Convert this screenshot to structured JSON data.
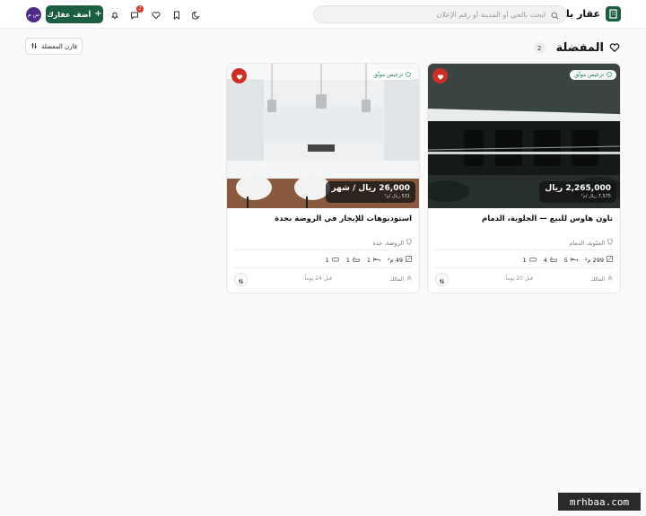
{
  "header": {
    "brand": "عقار بلس",
    "search_placeholder": "ابحث بالحي أو المدينة أو رقم الإعلان",
    "add_button": "أضف عقارك",
    "messages_badge": "2",
    "avatar_text": "س م"
  },
  "page": {
    "title": "المفضلة",
    "count": "2",
    "compare_button": "قارن المفضلة"
  },
  "cards": [
    {
      "verified": "ترخيص موثّق",
      "price": "2,265,000 ريال",
      "per_meter": "7,575 ريال /م²",
      "title": "تاون هاوس للبيع — الجلوية، الدمام",
      "location": "الجلوية، الدمام",
      "area": "299 م²",
      "beds": "5",
      "baths": "4",
      "rooms": "1",
      "owner": "المالك",
      "date": "قبل 20 يوماً"
    },
    {
      "verified": "ترخيص موثّق",
      "price": "26,000 ريال / شهر",
      "per_meter": "531 ريال /م²",
      "title": "استوديوهات للإيجار في الروضة بجدة",
      "location": "الروضة، جدة",
      "area": "49 م²",
      "beds": "1",
      "baths": "1",
      "rooms": "1",
      "owner": "المالك",
      "date": "قبل 24 يوماً"
    }
  ],
  "watermark": "mrhbaa.com",
  "colors": {
    "primary": "#1b5e40",
    "favorite": "#cf2e25",
    "verified_text": "#1b7a4d"
  }
}
